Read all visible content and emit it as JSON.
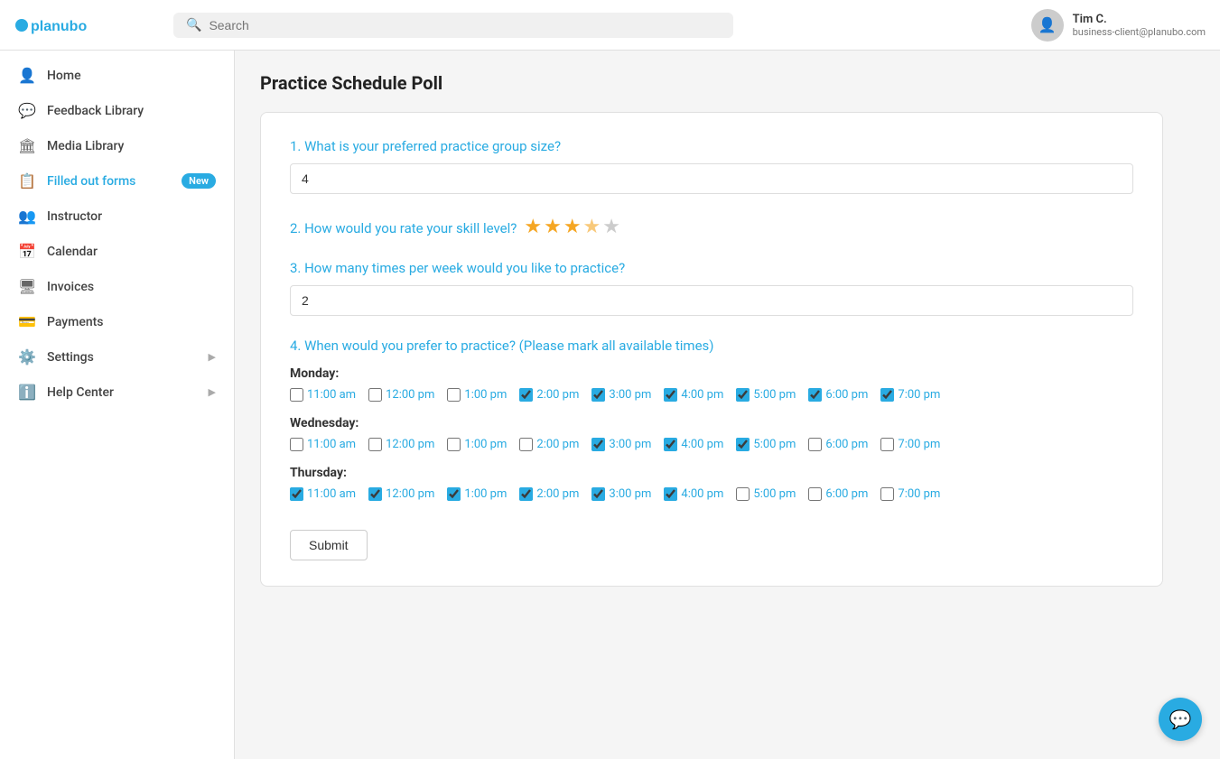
{
  "header": {
    "logo_text": "planubo",
    "search_placeholder": "Search",
    "user": {
      "name": "Tim C.",
      "email": "business-client@planubo.com"
    }
  },
  "sidebar": {
    "items": [
      {
        "id": "home",
        "label": "Home",
        "icon": "👤",
        "badge": null,
        "chevron": false
      },
      {
        "id": "feedback-library",
        "label": "Feedback Library",
        "icon": "💬",
        "badge": null,
        "chevron": false
      },
      {
        "id": "media-library",
        "label": "Media Library",
        "icon": "🏛",
        "badge": null,
        "chevron": false
      },
      {
        "id": "filled-out-forms",
        "label": "Filled out forms",
        "icon": "📋",
        "badge": "New",
        "chevron": false,
        "active": true
      },
      {
        "id": "instructor",
        "label": "Instructor",
        "icon": "👥",
        "badge": null,
        "chevron": false
      },
      {
        "id": "calendar",
        "label": "Calendar",
        "icon": "📅",
        "badge": null,
        "chevron": false
      },
      {
        "id": "invoices",
        "label": "Invoices",
        "icon": "🖥",
        "badge": null,
        "chevron": false
      },
      {
        "id": "payments",
        "label": "Payments",
        "icon": "💳",
        "badge": null,
        "chevron": false
      },
      {
        "id": "settings",
        "label": "Settings",
        "icon": "⚙️",
        "badge": null,
        "chevron": true
      },
      {
        "id": "help-center",
        "label": "Help Center",
        "icon": "ℹ️",
        "badge": null,
        "chevron": true
      }
    ]
  },
  "page": {
    "title": "Practice Schedule Poll",
    "questions": [
      {
        "id": "q1",
        "number": "1",
        "text": "What is your preferred practice group size?",
        "type": "text",
        "value": "4"
      },
      {
        "id": "q2",
        "number": "2",
        "text": "How would you rate your skill level?",
        "type": "rating",
        "rating": 3.5,
        "max_rating": 5
      },
      {
        "id": "q3",
        "number": "3",
        "text": "How many times per week would you like to practice?",
        "type": "text",
        "value": "2"
      },
      {
        "id": "q4",
        "number": "4",
        "text": "When would you prefer to practice? (Please mark all available times)",
        "type": "schedule",
        "days": [
          {
            "name": "Monday",
            "slots": [
              {
                "time": "11:00 am",
                "checked": false
              },
              {
                "time": "12:00 pm",
                "checked": false
              },
              {
                "time": "1:00 pm",
                "checked": false
              },
              {
                "time": "2:00 pm",
                "checked": true
              },
              {
                "time": "3:00 pm",
                "checked": true
              },
              {
                "time": "4:00 pm",
                "checked": true
              },
              {
                "time": "5:00 pm",
                "checked": true
              },
              {
                "time": "6:00 pm",
                "checked": true
              },
              {
                "time": "7:00 pm",
                "checked": true
              }
            ]
          },
          {
            "name": "Wednesday",
            "slots": [
              {
                "time": "11:00 am",
                "checked": false
              },
              {
                "time": "12:00 pm",
                "checked": false
              },
              {
                "time": "1:00 pm",
                "checked": false
              },
              {
                "time": "2:00 pm",
                "checked": false
              },
              {
                "time": "3:00 pm",
                "checked": true
              },
              {
                "time": "4:00 pm",
                "checked": true
              },
              {
                "time": "5:00 pm",
                "checked": true
              },
              {
                "time": "6:00 pm",
                "checked": false
              },
              {
                "time": "7:00 pm",
                "checked": false
              }
            ]
          },
          {
            "name": "Thursday",
            "slots": [
              {
                "time": "11:00 am",
                "checked": true
              },
              {
                "time": "12:00 pm",
                "checked": true
              },
              {
                "time": "1:00 pm",
                "checked": true
              },
              {
                "time": "2:00 pm",
                "checked": true
              },
              {
                "time": "3:00 pm",
                "checked": true
              },
              {
                "time": "4:00 pm",
                "checked": true
              },
              {
                "time": "5:00 pm",
                "checked": false
              },
              {
                "time": "6:00 pm",
                "checked": false
              },
              {
                "time": "7:00 pm",
                "checked": false
              }
            ]
          }
        ]
      }
    ],
    "submit_label": "Submit"
  }
}
